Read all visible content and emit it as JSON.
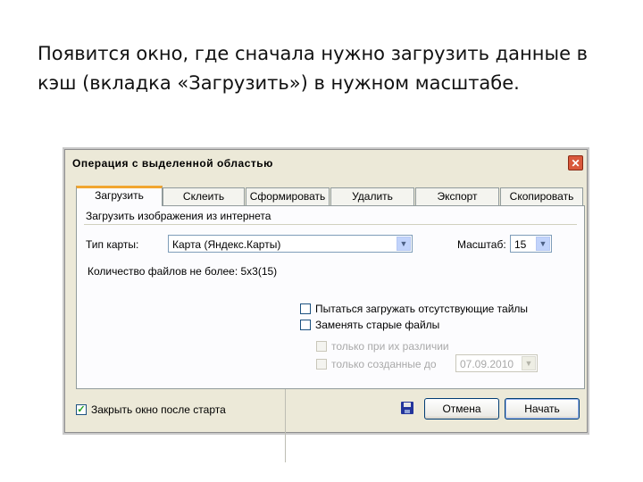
{
  "slide": {
    "line1": "Появится окно, где сначала нужно загрузить данные в",
    "line2": "кэш (вкладка «Загрузить») в нужном масштабе."
  },
  "dialog": {
    "title": "Операция с выделенной областью",
    "close_glyph": "✕",
    "tabs": [
      "Загрузить",
      "Склеить",
      "Сформировать",
      "Удалить",
      "Экспорт",
      "Скопировать"
    ],
    "active_tab": "Загрузить",
    "panel_heading": "Загрузить изображения из интернета",
    "map_type_label": "Тип карты:",
    "map_type_value": "Карта (Яндекс.Карты)",
    "scale_label": "Масштаб:",
    "scale_value": "15",
    "file_count_text": "Количество файлов не более: 5x3(15)",
    "options": {
      "try_missing": "Пытаться загружать отсутствующие тайлы",
      "replace_old": "Заменять старые файлы",
      "only_diff": "только при их различии",
      "only_created_before": "только созданные до",
      "date_value": "07.09.2010"
    },
    "close_after_start": {
      "label": "Закрыть окно после старта",
      "checked": true,
      "mark": "✓"
    },
    "buttons": {
      "cancel": "Отмена",
      "start": "Начать"
    }
  },
  "colors": {
    "dialog_bg": "#ece9d8",
    "tab_highlight": "#f1a630",
    "close_button": "#d9583b",
    "check_mark": "#21a121"
  },
  "icons": {
    "save": "floppy-disk-icon",
    "dropdown": "chevron-down-icon"
  }
}
